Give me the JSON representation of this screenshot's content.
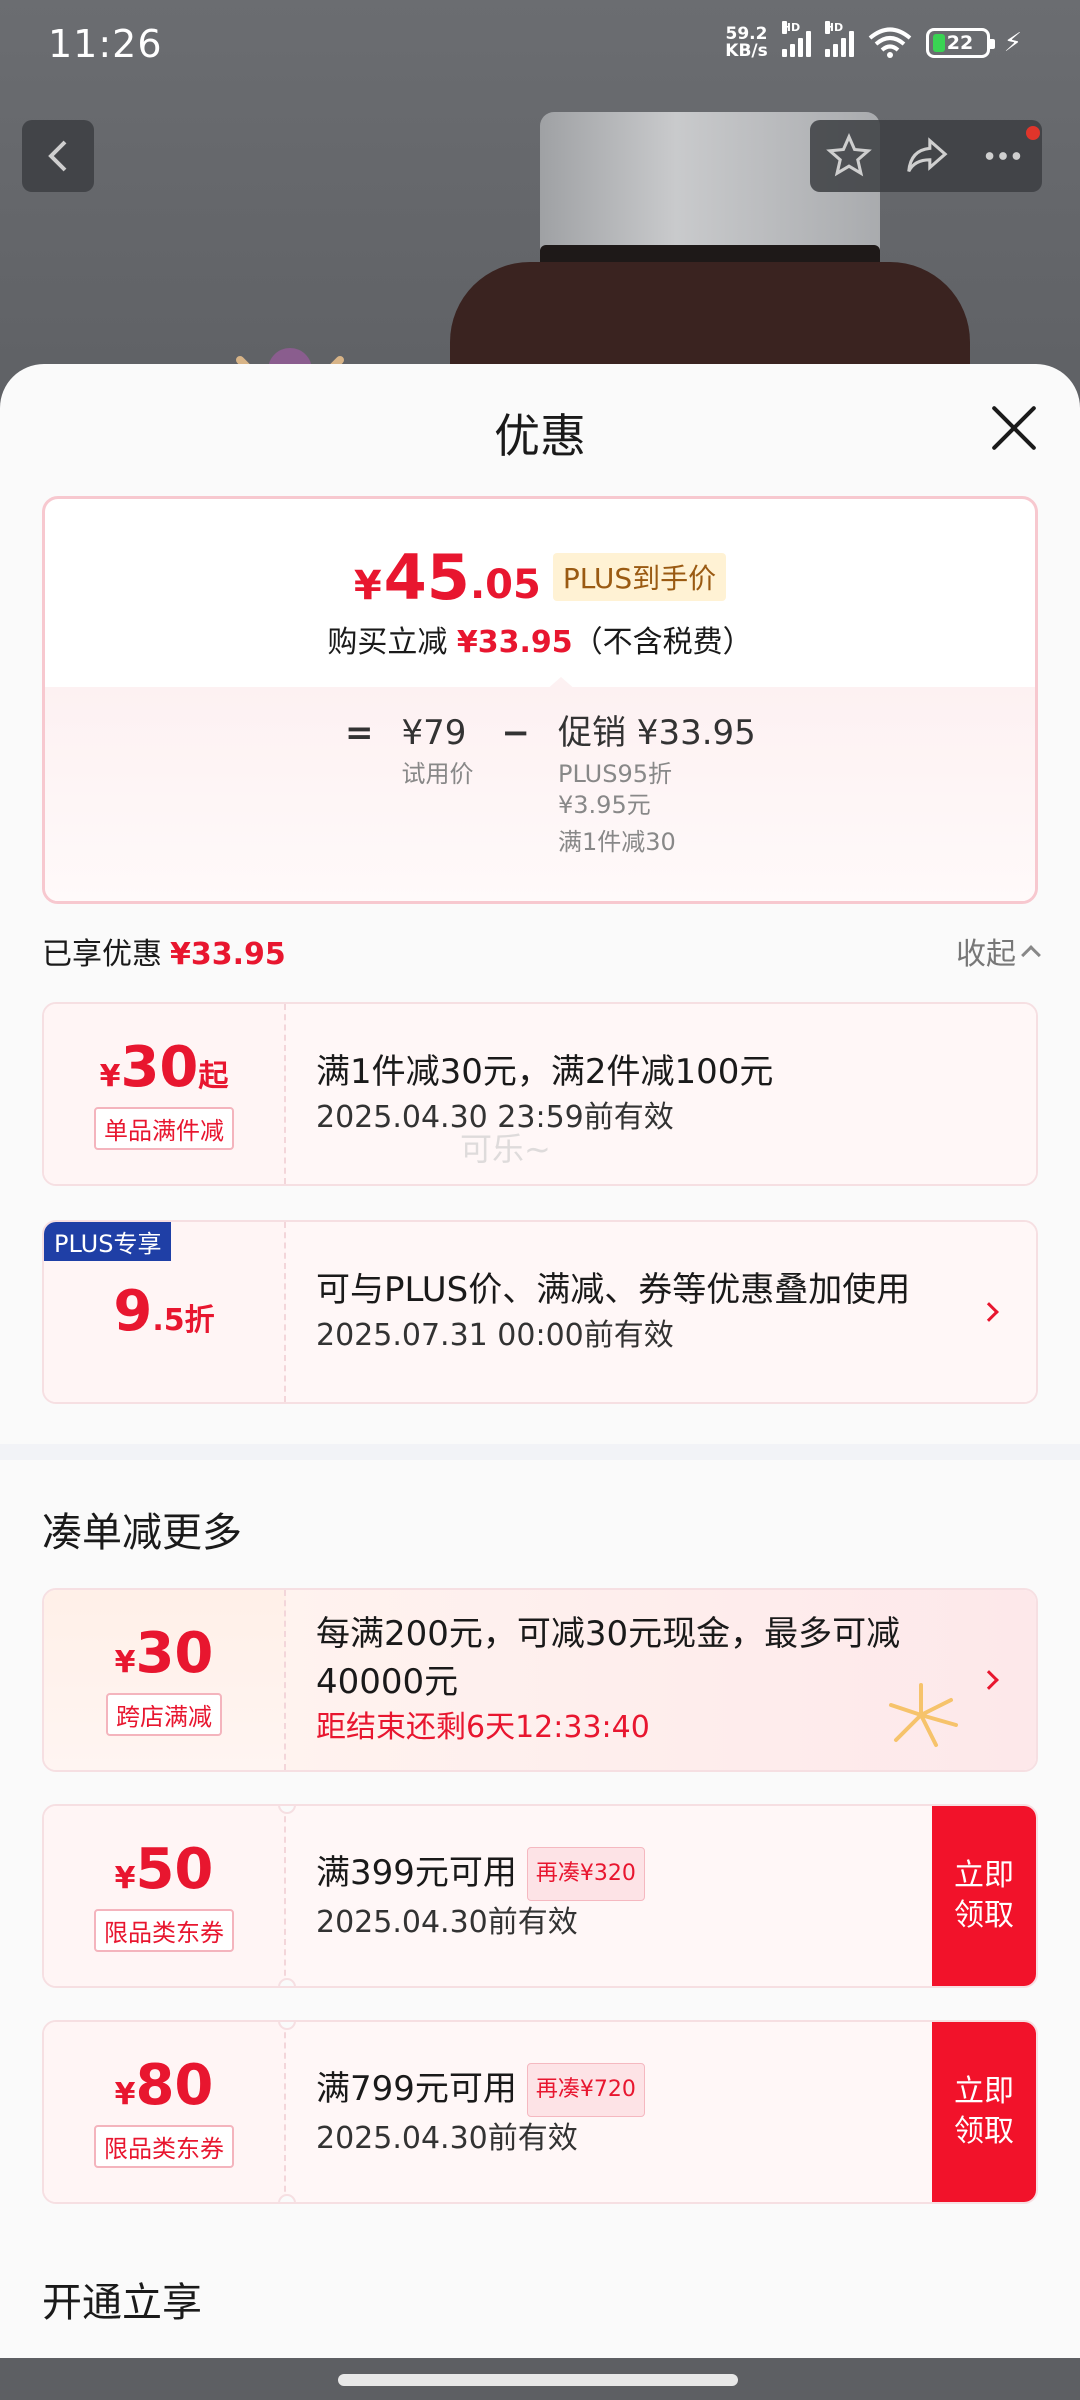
{
  "status_bar": {
    "time": "11:26",
    "net_speed_top": "59.2",
    "net_speed_bottom": "KB/s",
    "hd1": "HD",
    "hd2": "HD",
    "battery": "22"
  },
  "sheet": {
    "title": "优惠"
  },
  "summary": {
    "price_yen": "¥",
    "price_int": "45",
    "price_dec": ".05",
    "plus_tag": "PLUS到手价",
    "save_prefix": "购买立减",
    "save_amount": "¥33.95",
    "save_suffix": "（不含税费）",
    "eq": "=",
    "base_price": "¥79",
    "base_label": "试用价",
    "minus": "−",
    "promo_label_value": "促销 ¥33.95",
    "promo_line1": "PLUS95折",
    "promo_line2": "¥3.95元",
    "promo_line3": "满1件减30"
  },
  "enjoyed": {
    "label": "已享优惠",
    "amount": "¥33.95",
    "collapse": "收起"
  },
  "coupons": [
    {
      "amt_yen": "¥",
      "amt_num": "30",
      "amt_suffix": "起",
      "type": "单品满件减",
      "title": "满1件减30元，满2件减100元",
      "sub": "2025.04.30 23:59前有效"
    },
    {
      "badge": "PLUS专享",
      "amt_num": "9",
      "amt_suffix": ".5折",
      "title": "可与PLUS价、满减、券等优惠叠加使用",
      "sub": "2025.07.31 00:00前有效"
    }
  ],
  "more_section": {
    "title": "凑单减更多",
    "items": [
      {
        "amt_yen": "¥",
        "amt_num": "30",
        "type": "跨店满减",
        "title": "每满200元，可减30元现金，最多可减40000元",
        "countdown": "距结束还剩6天12:33:40"
      },
      {
        "amt_yen": "¥",
        "amt_num": "50",
        "type": "限品类东券",
        "title": "满399元可用",
        "gap": "再凑¥320",
        "sub": "2025.04.30前有效",
        "btn_line1": "立即",
        "btn_line2": "领取"
      },
      {
        "amt_yen": "¥",
        "amt_num": "80",
        "type": "限品类东券",
        "title": "满799元可用",
        "gap": "再凑¥720",
        "sub": "2025.04.30前有效",
        "btn_line1": "立即",
        "btn_line2": "领取"
      }
    ]
  },
  "open_section": {
    "title": "开通立享"
  },
  "watermark": "可乐~",
  "colors": {
    "accent": "#e8162f",
    "plus_blue": "#1f3fa6",
    "plus_tag_bg": "#fff2d4"
  }
}
